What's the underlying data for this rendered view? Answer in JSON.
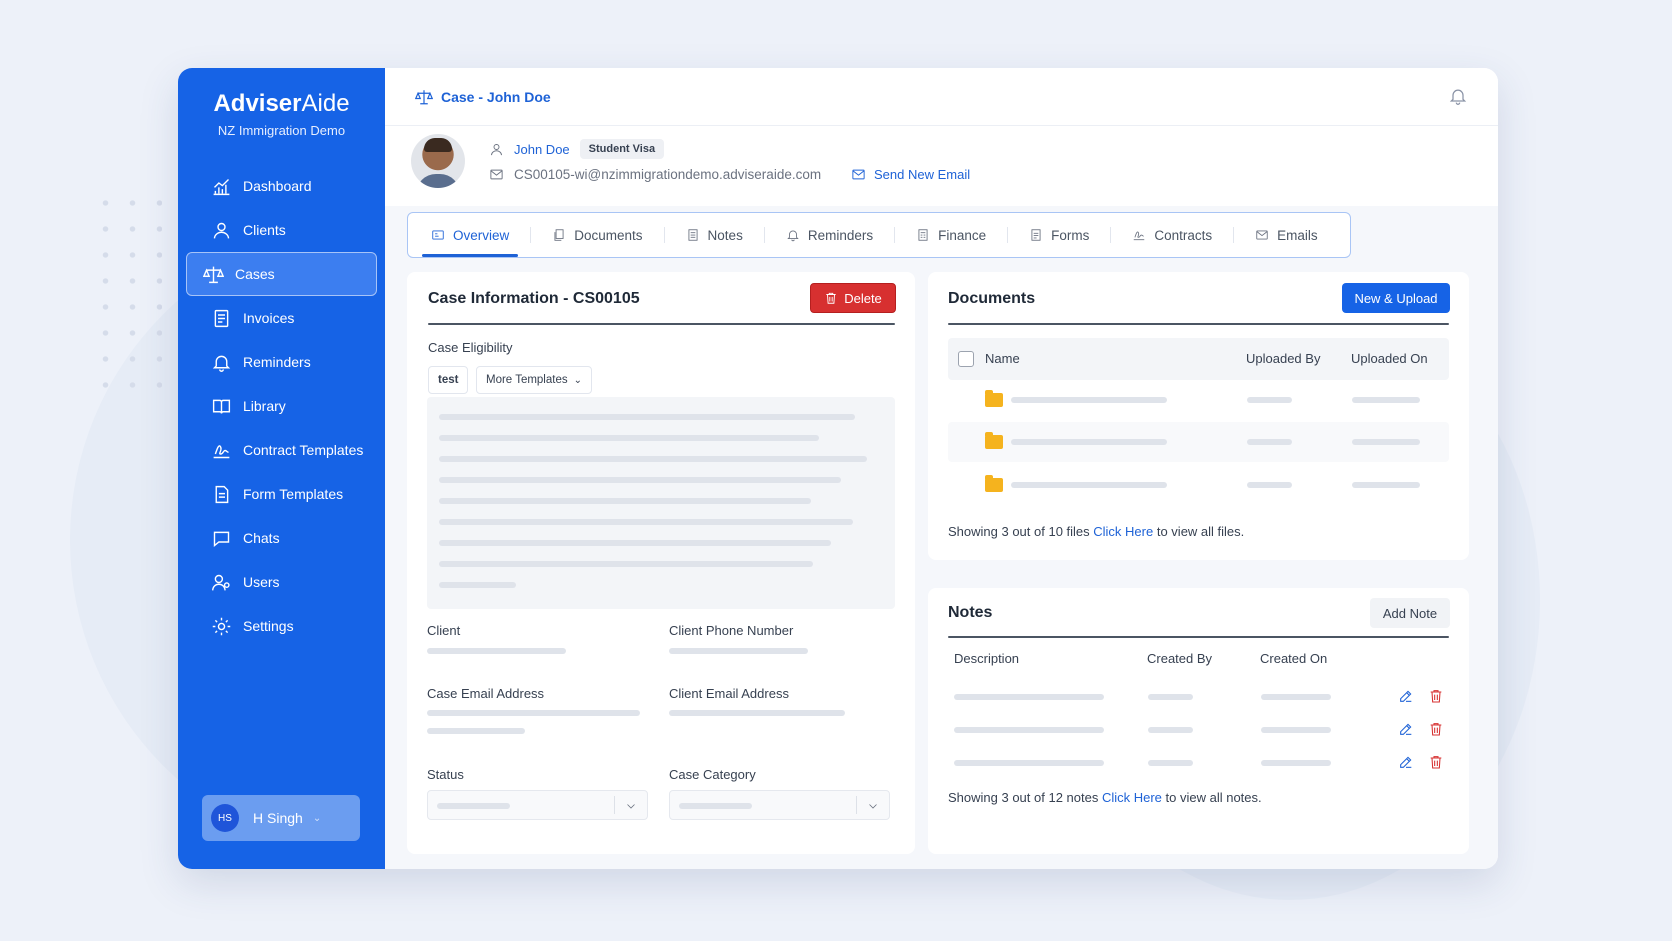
{
  "brand": {
    "name_bold": "Adviser",
    "name_light": "Aide",
    "subtitle": "NZ Immigration Demo"
  },
  "sidebar": {
    "items": [
      {
        "label": "Dashboard",
        "icon": "chart-icon"
      },
      {
        "label": "Clients",
        "icon": "user-icon"
      },
      {
        "label": "Cases",
        "icon": "scale-icon",
        "active": true
      },
      {
        "label": "Invoices",
        "icon": "invoice-icon"
      },
      {
        "label": "Reminders",
        "icon": "bell-icon"
      },
      {
        "label": "Library",
        "icon": "book-icon"
      },
      {
        "label": "Contract Templates",
        "icon": "signature-icon"
      },
      {
        "label": "Form Templates",
        "icon": "form-icon"
      },
      {
        "label": "Chats",
        "icon": "chat-icon"
      },
      {
        "label": "Users",
        "icon": "users-icon"
      },
      {
        "label": "Settings",
        "icon": "gear-icon"
      }
    ]
  },
  "user": {
    "initials": "HS",
    "name": "H Singh"
  },
  "header": {
    "title": "Case - John Doe"
  },
  "profile": {
    "name": "John Doe",
    "badge": "Student Visa",
    "email": "CS00105-wi@nzimmigrationdemo.adviseraide.com",
    "send_email": "Send New Email"
  },
  "tabs": [
    {
      "label": "Overview",
      "active": true
    },
    {
      "label": "Documents"
    },
    {
      "label": "Notes"
    },
    {
      "label": "Reminders"
    },
    {
      "label": "Finance"
    },
    {
      "label": "Forms"
    },
    {
      "label": "Contracts"
    },
    {
      "label": "Emails"
    }
  ],
  "case_info": {
    "title": "Case Information - CS00105",
    "delete": "Delete",
    "eligibility_label": "Case Eligibility",
    "template_chip": "test",
    "more_templates": "More Templates",
    "fields": {
      "client": "Client",
      "client_phone": "Client Phone Number",
      "case_email": "Case Email Address",
      "client_email": "Client Email Address",
      "status": "Status",
      "case_category": "Case Category"
    }
  },
  "documents": {
    "title": "Documents",
    "button": "New & Upload",
    "columns": [
      "Name",
      "Uploaded By",
      "Uploaded On"
    ],
    "footer_prefix": "Showing 3 out of 10 files ",
    "footer_link": "Click Here",
    "footer_suffix": " to view all files."
  },
  "notes": {
    "title": "Notes",
    "button": "Add Note",
    "columns": [
      "Description",
      "Created By",
      "Created On"
    ],
    "footer_prefix": "Showing 3 out of 12 notes ",
    "footer_link": "Click Here",
    "footer_suffix": " to view all notes."
  },
  "colors": {
    "primary": "#1663e6",
    "danger": "#d73030",
    "folder": "#f5b31e"
  }
}
